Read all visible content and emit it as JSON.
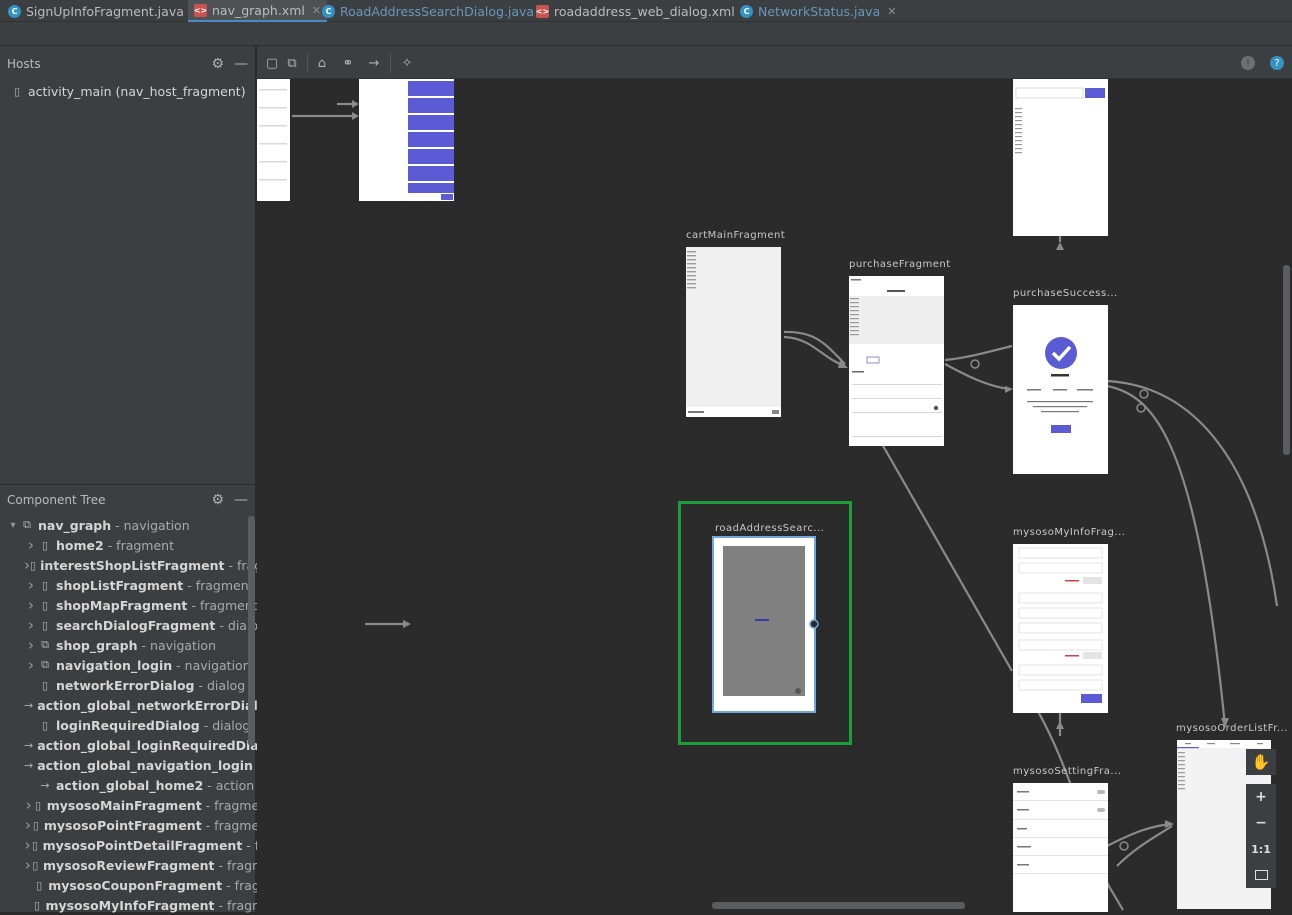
{
  "tabs": [
    {
      "label": "SignUpInfoFragment.java",
      "kind": "java",
      "active": false
    },
    {
      "label": "nav_graph.xml",
      "kind": "xml",
      "active": true
    },
    {
      "label": "RoadAddressSearchDialog.java",
      "kind": "java",
      "active": false
    },
    {
      "label": "roadaddress_web_dialog.xml",
      "kind": "xml",
      "active": false
    },
    {
      "label": "NetworkStatus.java",
      "kind": "java",
      "active": false
    }
  ],
  "hosts": {
    "title": "Hosts",
    "items": [
      {
        "label": "activity_main (nav_host_fragment)"
      }
    ]
  },
  "component_tree": {
    "title": "Component Tree",
    "rows": [
      {
        "name": "nav_graph",
        "type": "- navigation",
        "icon": "navigation-icon",
        "arrow": "v",
        "indent": 0
      },
      {
        "name": "home2",
        "type": "- fragment",
        "icon": "fragment-icon",
        "arrow": ">",
        "indent": 1
      },
      {
        "name": "interestShopListFragment",
        "type": "- fragm",
        "icon": "fragment-icon",
        "arrow": ">",
        "indent": 1
      },
      {
        "name": "shopListFragment",
        "type": "- fragment",
        "icon": "fragment-icon",
        "arrow": ">",
        "indent": 1
      },
      {
        "name": "shopMapFragment",
        "type": "- fragment",
        "icon": "fragment-icon",
        "arrow": ">",
        "indent": 1
      },
      {
        "name": "searchDialogFragment",
        "type": "- dialog",
        "icon": "fragment-icon",
        "arrow": ">",
        "indent": 1
      },
      {
        "name": "shop_graph",
        "type": "- navigation",
        "icon": "navigation-icon",
        "arrow": ">",
        "indent": 1
      },
      {
        "name": "navigation_login",
        "type": "- navigation",
        "icon": "navigation-icon",
        "arrow": ">",
        "indent": 1
      },
      {
        "name": "networkErrorDialog",
        "type": "- dialog",
        "icon": "fragment-icon",
        "arrow": "",
        "indent": 1
      },
      {
        "name": "action_global_networkErrorDialog",
        "type": "",
        "icon": "action-icon",
        "arrow": "",
        "indent": 1
      },
      {
        "name": "loginRequiredDialog",
        "type": "- dialog",
        "icon": "fragment-icon",
        "arrow": "",
        "indent": 1
      },
      {
        "name": "action_global_loginRequiredDialog",
        "type": "",
        "icon": "action-icon",
        "arrow": "",
        "indent": 1
      },
      {
        "name": "action_global_navigation_login",
        "type": "- a",
        "icon": "action-icon",
        "arrow": "",
        "indent": 1
      },
      {
        "name": "action_global_home2",
        "type": "- action",
        "icon": "action-icon",
        "arrow": "",
        "indent": 1
      },
      {
        "name": "mysosoMainFragment",
        "type": "- fragment",
        "icon": "fragment-icon",
        "arrow": ">",
        "indent": 1
      },
      {
        "name": "mysosoPointFragment",
        "type": "- fragment",
        "icon": "fragment-icon",
        "arrow": ">",
        "indent": 1
      },
      {
        "name": "mysosoPointDetailFragment",
        "type": "- fra",
        "icon": "fragment-icon",
        "arrow": ">",
        "indent": 1
      },
      {
        "name": "mysosoReviewFragment",
        "type": "- fragme",
        "icon": "fragment-icon",
        "arrow": ">",
        "indent": 1
      },
      {
        "name": "mysosoCouponFragment",
        "type": "- fragm",
        "icon": "fragment-icon",
        "arrow": "",
        "indent": 1
      },
      {
        "name": "mysosoMyInfoFragment",
        "type": "- fragme",
        "icon": "fragment-icon",
        "arrow": "",
        "indent": 1
      }
    ]
  },
  "destinations": {
    "cart": "cartMainFragment",
    "purchase": "purchaseFragment",
    "purchase_success": "purchaseSuccess...",
    "road_address": "roadAddressSearc...",
    "myinfo": "mysosoMyInfoFrag...",
    "setting": "mysosoSettingFra...",
    "orderlist": "mysosoOrderListFr..."
  },
  "zoom_controls": {
    "plus": "+",
    "minus": "−",
    "one_to_one": "1:1"
  },
  "colors": {
    "accent": "#5b5bd6",
    "selection": "#1a9f3a",
    "tab_underline": "#4a88c7"
  }
}
